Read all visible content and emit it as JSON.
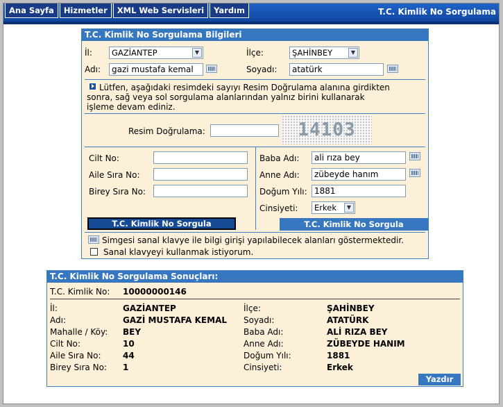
{
  "menu": [
    "Ana Sayfa",
    "Hizmetler",
    "XML Web Servisleri",
    "Yardım"
  ],
  "header_title": "T.C. Kimlik No Sorgulama",
  "form": {
    "title": "T.C. Kimlik No Sorgulama Bilgileri",
    "il_label": "İl:",
    "il_value": "GAZİANTEP",
    "ilce_label": "İlçe:",
    "ilce_value": "ŞAHİNBEY",
    "adi_label": "Adı:",
    "adi_value": "gazi mustafa kemal",
    "soyadi_label": "Soyadı:",
    "soyadi_value": "atatürk",
    "info_text_1": "Lütfen, aşağıdaki resimdeki sayıyı Resim Doğrulama alanına girdikten",
    "info_text_2": "sonra, sağ veya sol sorgulama alanlarından yalnız birini kullanarak",
    "info_text_3": "işleme devam ediniz.",
    "captcha_label": "Resim Doğrulama:",
    "captcha_value": "",
    "captcha_image_text": "14103",
    "cilt_label": "Cilt No:",
    "aile_label": "Aile Sıra No:",
    "birey_label": "Birey Sıra No:",
    "baba_label": "Baba Adı:",
    "baba_value": "ali rıza bey",
    "anne_label": "Anne Adı:",
    "anne_value": "zübeyde hanım",
    "dogum_label": "Doğum Yılı:",
    "dogum_value": "1881",
    "cinsiyet_label": "Cinsiyeti:",
    "cinsiyet_value": "Erkek",
    "query_button_left": "T.C. Kimlik No Sorgula",
    "query_button_right": "T.C. Kimlik No Sorgula",
    "keyboard_note": "Simgesi sanal klavye ile bilgi girişi yapılabilecek alanları göstermektedir.",
    "keyboard_checkbox": "Sanal klavyeyi kullanmak istiyorum."
  },
  "results": {
    "title": "T.C. Kimlik No Sorgulama Sonuçları:",
    "tc_label": "T.C. Kimlik No:",
    "tc_value": "10000000146",
    "il_label": "İl:",
    "il_value": "GAZİANTEP",
    "ilce_label": "İlçe:",
    "ilce_value": "ŞAHİNBEY",
    "adi_label": "Adı:",
    "adi_value": "GAZİ MUSTAFA KEMAL",
    "soyadi_label": "Soyadı:",
    "soyadi_value": "ATATÜRK",
    "mahalle_label": "Mahalle / Köy:",
    "mahalle_value": "BEY",
    "baba_label": "Baba Adı:",
    "baba_value": "ALİ RIZA BEY",
    "cilt_label": "Cilt No:",
    "cilt_value": "10",
    "anne_label": "Anne Adı:",
    "anne_value": "ZÜBEYDE HANIM",
    "aile_label": "Aile Sıra No:",
    "aile_value": "44",
    "dogum_label": "Doğum Yılı:",
    "dogum_value": "1881",
    "birey_label": "Birey Sıra No:",
    "birey_value": "1",
    "cinsiyet_label": "Cinsiyeti:",
    "cinsiyet_value": "Erkek",
    "print_button": "Yazdır"
  },
  "colors": {
    "header_blue": "#3677c0",
    "panel_bg": "#fdf0d8",
    "topbar_blue": "#1f64c8"
  }
}
